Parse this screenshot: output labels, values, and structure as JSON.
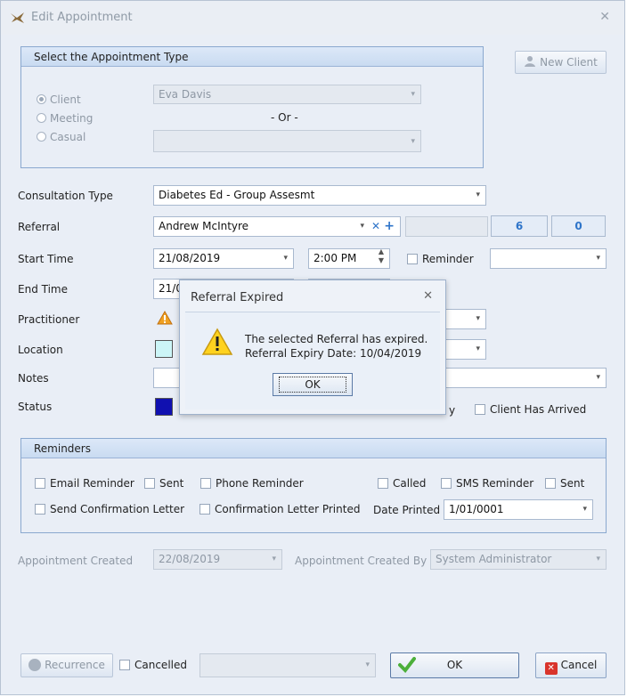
{
  "window": {
    "title": "Edit Appointment",
    "close_glyph": "✕"
  },
  "appointment_type": {
    "header": "Select the Appointment Type",
    "options": [
      "Client",
      "Meeting",
      "Casual"
    ],
    "selected": "Client",
    "client_value": "Eva Davis",
    "or_label": "- Or -",
    "other_value": ""
  },
  "new_client_button": "New Client",
  "form": {
    "consultation_type_label": "Consultation Type",
    "consultation_type_value": "Diabetes Ed - Group Assesmt",
    "referral_label": "Referral",
    "referral_value": "Andrew McIntyre",
    "referral_count_1": "6",
    "referral_count_2": "0",
    "start_time_label": "Start Time",
    "start_date": "21/08/2019",
    "start_time": "2:00 PM",
    "reminder_label": "Reminder",
    "end_time_label": "End Time",
    "end_date_partial": "21/0",
    "practitioner_label": "Practitioner",
    "location_label": "Location",
    "notes_label": "Notes",
    "status_label": "Status",
    "status_partial_text": "y",
    "client_arrived_label": "Client Has Arrived",
    "location_color": "#ccf5f7",
    "status_color": "#1010b0"
  },
  "reminders": {
    "header": "Reminders",
    "email_reminder": "Email Reminder",
    "sent_1": "Sent",
    "phone_reminder": "Phone Reminder",
    "called": "Called",
    "sms_reminder": "SMS Reminder",
    "sent_2": "Sent",
    "send_confirmation": "Send Confirmation Letter",
    "confirmation_printed": "Confirmation Letter Printed",
    "date_printed_label": "Date Printed",
    "date_printed_value": "1/01/0001"
  },
  "created": {
    "created_label": "Appointment Created",
    "created_value": "22/08/2019",
    "created_by_label": "Appointment Created By",
    "created_by_value": "System Administrator"
  },
  "footer": {
    "recurrence": "Recurrence",
    "cancelled": "Cancelled",
    "ok": "OK",
    "cancel": "Cancel"
  },
  "modal": {
    "title": "Referral Expired",
    "line1": "The selected Referral has expired.",
    "line2": "Referral Expiry Date: 10/04/2019",
    "ok": "OK"
  }
}
